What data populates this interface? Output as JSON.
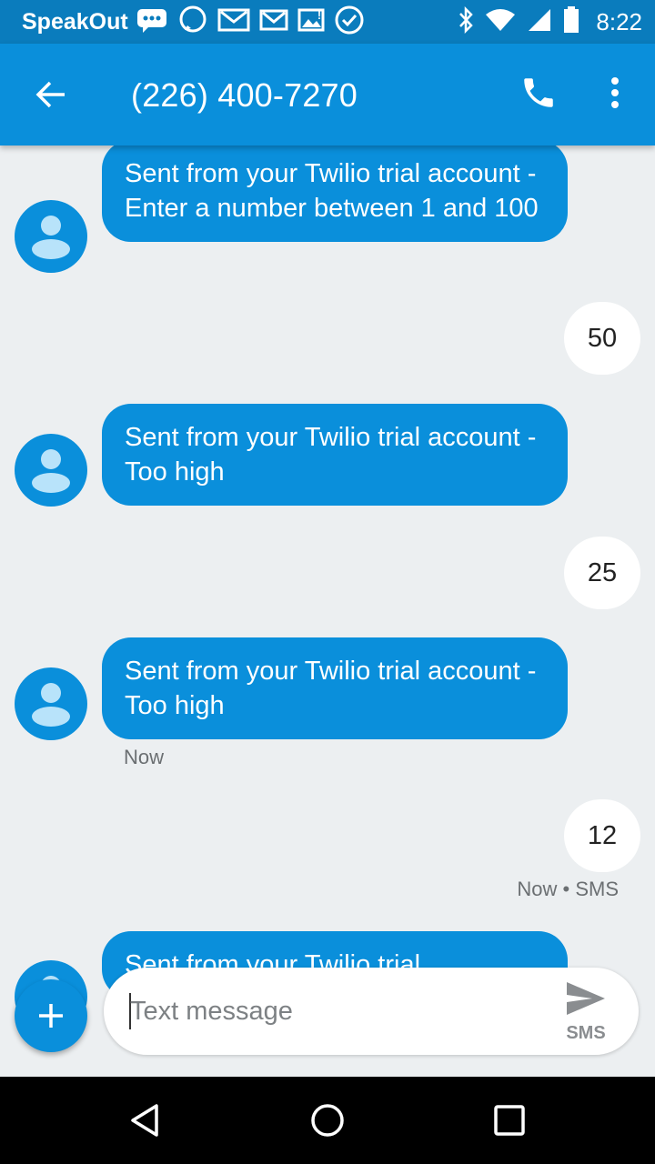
{
  "status_bar": {
    "carrier": "SpeakOut",
    "time": "8:22",
    "icons": [
      "chat-bubble-icon",
      "messenger-icon",
      "gmail-icon",
      "gmail-icon",
      "image-icon",
      "check-circle-icon",
      "bluetooth-icon",
      "wifi-icon",
      "signal-icon",
      "battery-icon"
    ]
  },
  "header": {
    "title": "(226) 400-7270",
    "back_icon": "arrow-back-icon",
    "call_icon": "phone-icon",
    "more_icon": "more-vert-icon"
  },
  "messages": [
    {
      "direction": "incoming",
      "text": "Sent from your Twilio trial account - Enter a number between 1 and 100"
    },
    {
      "direction": "outgoing",
      "text": "50"
    },
    {
      "direction": "incoming",
      "text": "Sent from your Twilio trial account - Too high"
    },
    {
      "direction": "outgoing",
      "text": "25"
    },
    {
      "direction": "incoming",
      "text": "Sent from your Twilio trial account - Too high",
      "meta": "Now"
    },
    {
      "direction": "outgoing",
      "text": "12",
      "meta": "Now • SMS"
    },
    {
      "direction": "incoming",
      "text": "Sent from your Twilio trial"
    }
  ],
  "compose": {
    "placeholder": "Text message",
    "send_label": "SMS",
    "attach_icon": "plus-icon",
    "send_icon": "send-icon"
  },
  "nav_bar": {
    "icons": [
      "back-triangle-icon",
      "home-circle-icon",
      "recents-square-icon"
    ]
  },
  "colors": {
    "status_bar": "#0a7cbd",
    "app_bar": "#0a8fdb",
    "incoming_bubble": "#0a8fdb",
    "outgoing_bubble": "#ffffff",
    "background": "#eceff1"
  }
}
